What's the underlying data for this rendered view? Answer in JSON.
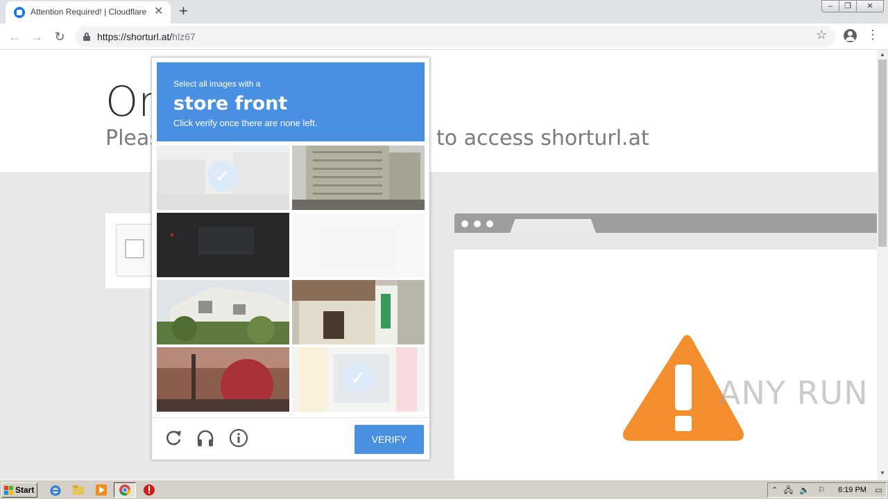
{
  "browser": {
    "tab_title": "Attention Required! | Cloudflare",
    "url_host": "https://shorturl.at/",
    "url_path": "hlz67"
  },
  "page": {
    "headline": "On",
    "subhead_left": "Pleas",
    "subhead_right": "to access shorturl.at"
  },
  "captcha": {
    "instruction_small": "Select all images with a",
    "target": "store front",
    "instruction_note": "Click verify once there are none left.",
    "verify_label": "VERIFY",
    "tiles": [
      {
        "id": 1,
        "state": "selected"
      },
      {
        "id": 2,
        "state": "unselected"
      },
      {
        "id": 3,
        "state": "unselected"
      },
      {
        "id": 4,
        "state": "selected"
      },
      {
        "id": 5,
        "state": "unselected"
      },
      {
        "id": 6,
        "state": "unselected"
      },
      {
        "id": 7,
        "state": "unselected"
      },
      {
        "id": 8,
        "state": "selected"
      }
    ],
    "accent_color": "#4a90e2"
  },
  "watermark": "ANY RUN",
  "taskbar": {
    "start_label": "Start",
    "clock": "6:19 PM"
  },
  "icons": {
    "back": "arrow-left-icon",
    "forward": "arrow-right-icon",
    "reload": "reload-icon",
    "lock": "lock-icon",
    "star": "star-icon",
    "profile": "profile-icon",
    "menu": "kebab-menu-icon",
    "warning": "warning-icon",
    "audio": "headphones-icon",
    "info": "info-icon"
  }
}
